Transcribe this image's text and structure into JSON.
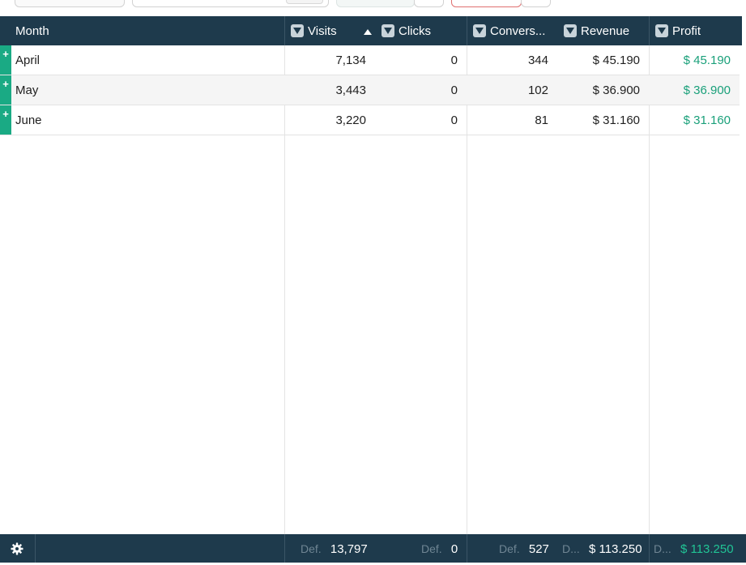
{
  "header": {
    "columns": {
      "month": "Month",
      "visits": "Visits",
      "clicks": "Clicks",
      "conversions": "Convers...",
      "revenue": "Revenue",
      "profit": "Profit"
    }
  },
  "rows": [
    {
      "expander": "+",
      "month": "April",
      "visits": "7,134",
      "clicks": "0",
      "conversions": "344",
      "revenue": "$ 45.190",
      "profit": "$ 45.190"
    },
    {
      "expander": "+",
      "month": "May",
      "visits": "3,443",
      "clicks": "0",
      "conversions": "102",
      "revenue": "$ 36.900",
      "profit": "$ 36.900"
    },
    {
      "expander": "+",
      "month": "June",
      "visits": "3,220",
      "clicks": "0",
      "conversions": "81",
      "revenue": "$ 31.160",
      "profit": "$ 31.160"
    }
  ],
  "footer": {
    "visits": {
      "agg": "Def.",
      "value": "13,797"
    },
    "clicks": {
      "agg": "Def.",
      "value": "0"
    },
    "conversions": {
      "agg": "Def.",
      "value": "527"
    },
    "revenue": {
      "agg": "D...",
      "value": "$ 113.250"
    },
    "profit": {
      "agg": "D...",
      "value": "$ 113.250"
    }
  },
  "colors": {
    "header_bg": "#1e3a4c",
    "accent_green": "#1aaa84",
    "profit_text": "#1aa07a",
    "row_alt": "#f5f5f5"
  },
  "icons": {
    "filter": "filter-icon",
    "sort": "sort-ascending-icon",
    "expand": "expand-row-icon",
    "settings": "gear-icon"
  }
}
